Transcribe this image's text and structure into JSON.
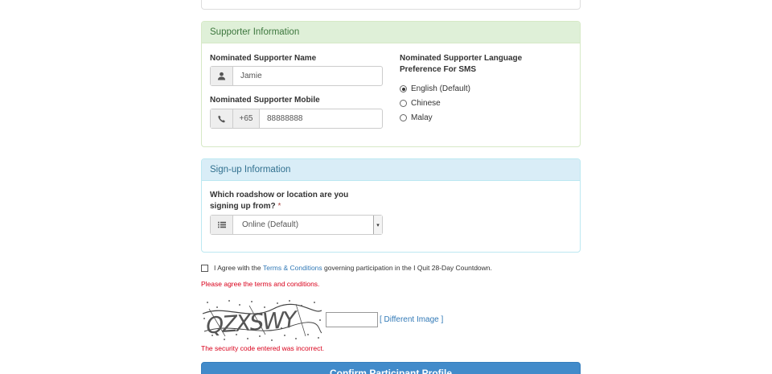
{
  "supporter": {
    "heading": "Supporter Information",
    "name_label": "Nominated Supporter Name",
    "name_value": "Jamie",
    "mobile_label": "Nominated Supporter Mobile",
    "country_code": "+65",
    "mobile_value": "88888888",
    "language_label_line1": "Nominated Supporter Language",
    "language_label_line2": "Preference For SMS",
    "languages": [
      {
        "label": "English (Default)",
        "selected": true
      },
      {
        "label": "Chinese",
        "selected": false
      },
      {
        "label": "Malay",
        "selected": false
      }
    ]
  },
  "signup": {
    "heading": "Sign-up Information",
    "question_line1": "Which roadshow or location are you",
    "question_line2": "signing up from?",
    "required_mark": "*",
    "location_value": "Online (Default)"
  },
  "terms": {
    "prefix": "I Agree with the",
    "link_text": "Terms & Conditions",
    "suffix": "governing participation in the I Quit 28-Day Countdown.",
    "error": "Please agree the terms and conditions."
  },
  "captcha": {
    "image_text": "QZXSWY",
    "input_value": "",
    "different_image_label": "[ Different Image ]",
    "error": "The security code entered was incorrect."
  },
  "confirm_button_label": "Confirm Participant Profile",
  "colors": {
    "success_bg": "#dff0d8",
    "success_text": "#3c763d",
    "info_bg": "#d9edf7",
    "info_text": "#31708f",
    "link": "#337ab7",
    "error": "#d9001b",
    "primary": "#428bca"
  }
}
